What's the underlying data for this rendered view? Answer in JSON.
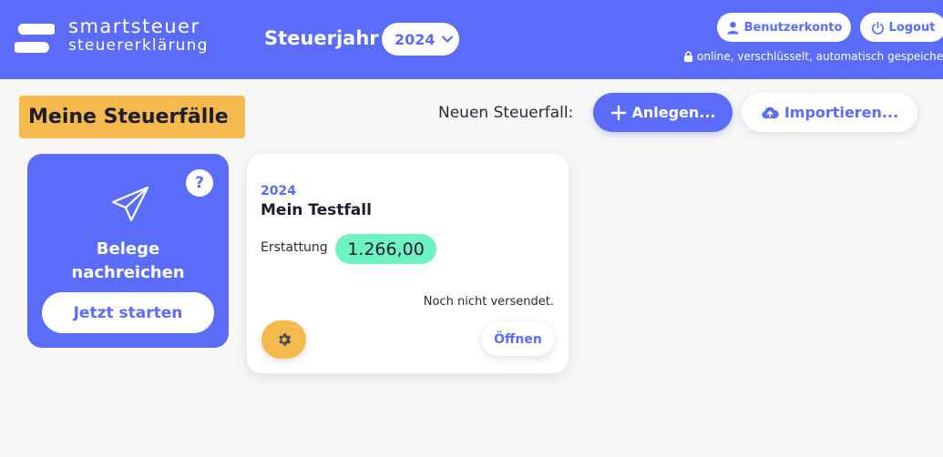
{
  "header": {
    "logo_line1": "smartsteuer",
    "logo_line2": "steuererklärung",
    "year_label": "Steuerjahr",
    "selected_year": "2024",
    "account_label": "Benutzerkonto",
    "logout_label": "Logout",
    "secure_note": "online, verschlüsselt, automatisch gespeichert"
  },
  "main": {
    "title": "Meine Steuerfälle",
    "new_case_label": "Neuen Steuerfall:",
    "create_label": "Anlegen...",
    "import_label": "Importieren..."
  },
  "belege_card": {
    "help": "?",
    "title_line1": "Belege",
    "title_line2": "nachreichen",
    "start_label": "Jetzt starten"
  },
  "case": {
    "year": "2024",
    "name": "Mein Testfall",
    "refund_label": "Erstattung",
    "refund_value": "1.266,00",
    "status": "Noch nicht versendet.",
    "open_label": "Öffnen"
  },
  "colors": {
    "brand": "#5b6cf9",
    "accent": "#f5b94e",
    "refund": "#6ff2c2",
    "background": "#f8f7f6"
  },
  "icons": [
    "logo-mark-icon",
    "chevron-down-icon",
    "user-icon",
    "power-icon",
    "lock-icon",
    "plus-icon",
    "cloud-upload-icon",
    "paper-plane-icon",
    "question-icon",
    "gear-icon"
  ]
}
